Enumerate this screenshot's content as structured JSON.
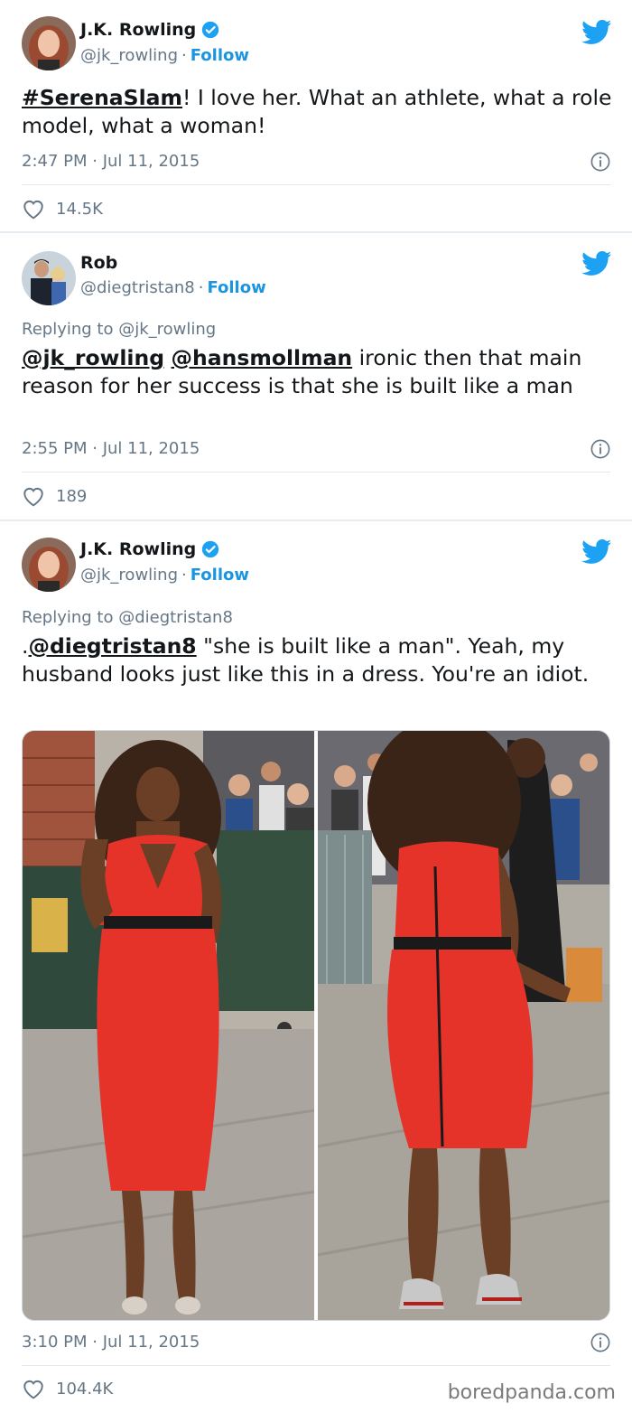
{
  "colors": {
    "link_blue": "#1b95e0",
    "text": "#14171a",
    "secondary": "#657786",
    "dress_red": "#e5332a"
  },
  "tweets": [
    {
      "name": "J.K. Rowling",
      "handle": "@jk_rowling",
      "separator": "·",
      "follow": "Follow",
      "verified": true,
      "text_link": "#SerenaSlam",
      "text_rest": "! I love her. What an athlete, what a role model, what a woman!",
      "timestamp": "2:47 PM · Jul 11, 2015",
      "likes": "14.5K"
    },
    {
      "name": "Rob",
      "handle": "@diegtristan8",
      "separator": "·",
      "follow": "Follow",
      "verified": false,
      "replying_to": "Replying to @jk_rowling",
      "mention1": "@jk_rowling",
      "mention2": "@hansmollman",
      "text_rest": "ironic then that main reason for her success is that she is built like a man",
      "timestamp": "2:55 PM · Jul 11, 2015",
      "likes": "189"
    },
    {
      "name": "J.K. Rowling",
      "handle": "@jk_rowling",
      "separator": "·",
      "follow": "Follow",
      "verified": true,
      "replying_to": "Replying to @diegtristan8",
      "text_prefix": ".",
      "mention1": "@diegtristan8",
      "text_rest": "\"she is built like a man\". Yeah, my husband looks just like this in a dress. You're an idiot.",
      "timestamp": "3:10 PM · Jul 11, 2015",
      "likes": "104.4K"
    }
  ],
  "watermark": "boredpanda.com",
  "icons": {
    "bird": "twitter-bird-icon",
    "verified": "verified-badge-icon",
    "info": "info-icon",
    "heart": "heart-icon"
  }
}
